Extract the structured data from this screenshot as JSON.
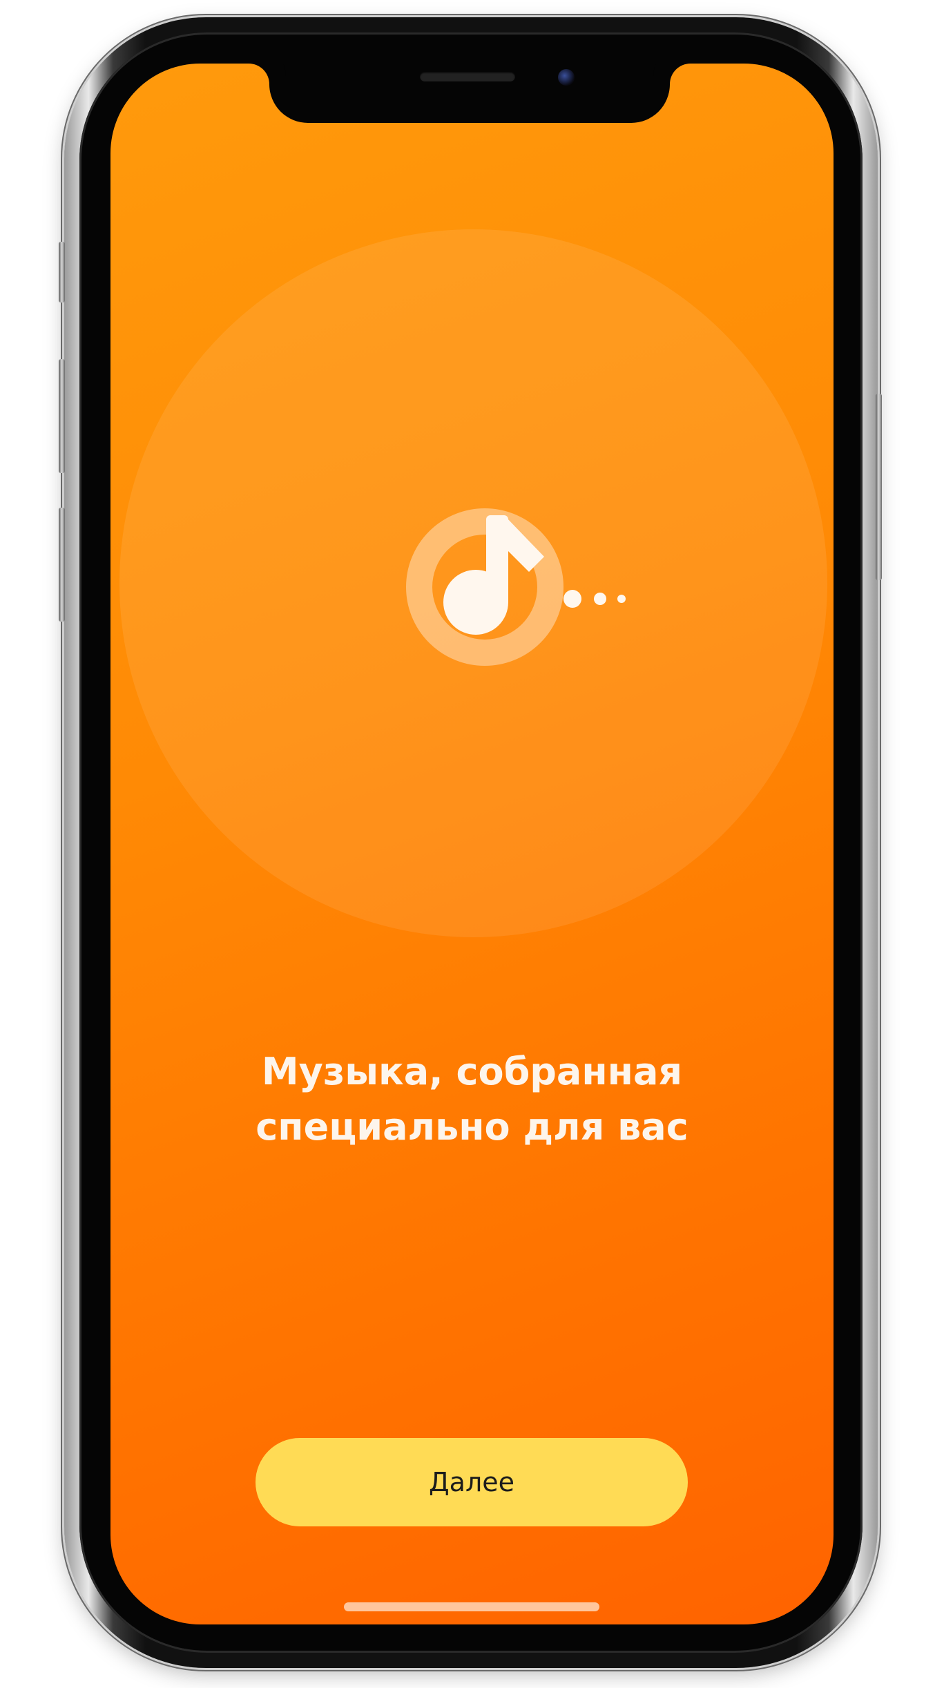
{
  "device": {
    "model": "phone",
    "icons": [
      "speaker-icon",
      "front-camera-icon"
    ]
  },
  "screen": {
    "logo": {
      "icon": "music-note-logo-icon",
      "dots_icon": "loading-dots-icon"
    },
    "headline": {
      "line1": "Музыка, собранная",
      "line2": "специально для вас"
    },
    "primary_button": {
      "label": "Далее"
    }
  },
  "colors": {
    "background_start": "#ff9a0c",
    "background_end": "#ff6300",
    "button": "#ffdb55",
    "headline_text": "#fdf5ec"
  }
}
